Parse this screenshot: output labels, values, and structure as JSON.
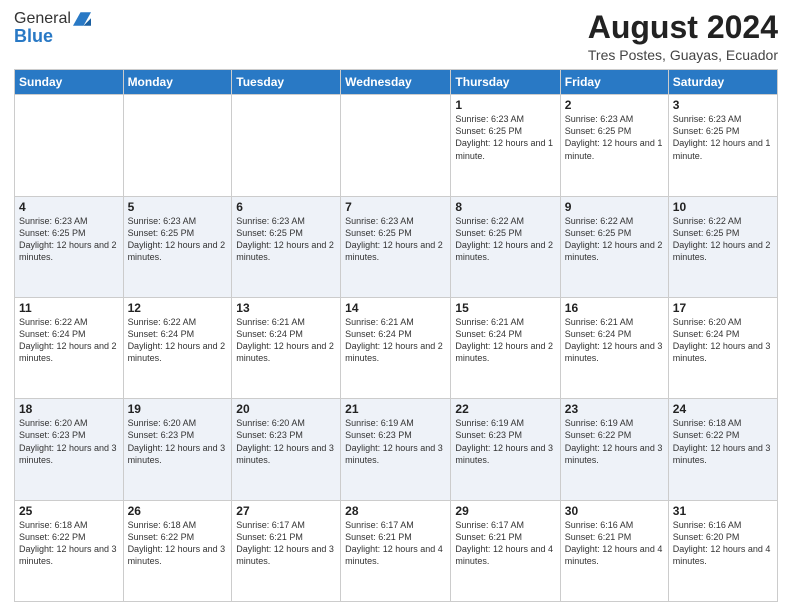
{
  "logo": {
    "general": "General",
    "blue": "Blue"
  },
  "header": {
    "month": "August 2024",
    "location": "Tres Postes, Guayas, Ecuador"
  },
  "weekdays": [
    "Sunday",
    "Monday",
    "Tuesday",
    "Wednesday",
    "Thursday",
    "Friday",
    "Saturday"
  ],
  "weeks": [
    [
      {
        "day": "",
        "info": ""
      },
      {
        "day": "",
        "info": ""
      },
      {
        "day": "",
        "info": ""
      },
      {
        "day": "",
        "info": ""
      },
      {
        "day": "1",
        "info": "Sunrise: 6:23 AM\nSunset: 6:25 PM\nDaylight: 12 hours and 1 minute."
      },
      {
        "day": "2",
        "info": "Sunrise: 6:23 AM\nSunset: 6:25 PM\nDaylight: 12 hours and 1 minute."
      },
      {
        "day": "3",
        "info": "Sunrise: 6:23 AM\nSunset: 6:25 PM\nDaylight: 12 hours and 1 minute."
      }
    ],
    [
      {
        "day": "4",
        "info": "Sunrise: 6:23 AM\nSunset: 6:25 PM\nDaylight: 12 hours and 2 minutes."
      },
      {
        "day": "5",
        "info": "Sunrise: 6:23 AM\nSunset: 6:25 PM\nDaylight: 12 hours and 2 minutes."
      },
      {
        "day": "6",
        "info": "Sunrise: 6:23 AM\nSunset: 6:25 PM\nDaylight: 12 hours and 2 minutes."
      },
      {
        "day": "7",
        "info": "Sunrise: 6:23 AM\nSunset: 6:25 PM\nDaylight: 12 hours and 2 minutes."
      },
      {
        "day": "8",
        "info": "Sunrise: 6:22 AM\nSunset: 6:25 PM\nDaylight: 12 hours and 2 minutes."
      },
      {
        "day": "9",
        "info": "Sunrise: 6:22 AM\nSunset: 6:25 PM\nDaylight: 12 hours and 2 minutes."
      },
      {
        "day": "10",
        "info": "Sunrise: 6:22 AM\nSunset: 6:25 PM\nDaylight: 12 hours and 2 minutes."
      }
    ],
    [
      {
        "day": "11",
        "info": "Sunrise: 6:22 AM\nSunset: 6:24 PM\nDaylight: 12 hours and 2 minutes."
      },
      {
        "day": "12",
        "info": "Sunrise: 6:22 AM\nSunset: 6:24 PM\nDaylight: 12 hours and 2 minutes."
      },
      {
        "day": "13",
        "info": "Sunrise: 6:21 AM\nSunset: 6:24 PM\nDaylight: 12 hours and 2 minutes."
      },
      {
        "day": "14",
        "info": "Sunrise: 6:21 AM\nSunset: 6:24 PM\nDaylight: 12 hours and 2 minutes."
      },
      {
        "day": "15",
        "info": "Sunrise: 6:21 AM\nSunset: 6:24 PM\nDaylight: 12 hours and 2 minutes."
      },
      {
        "day": "16",
        "info": "Sunrise: 6:21 AM\nSunset: 6:24 PM\nDaylight: 12 hours and 3 minutes."
      },
      {
        "day": "17",
        "info": "Sunrise: 6:20 AM\nSunset: 6:24 PM\nDaylight: 12 hours and 3 minutes."
      }
    ],
    [
      {
        "day": "18",
        "info": "Sunrise: 6:20 AM\nSunset: 6:23 PM\nDaylight: 12 hours and 3 minutes."
      },
      {
        "day": "19",
        "info": "Sunrise: 6:20 AM\nSunset: 6:23 PM\nDaylight: 12 hours and 3 minutes."
      },
      {
        "day": "20",
        "info": "Sunrise: 6:20 AM\nSunset: 6:23 PM\nDaylight: 12 hours and 3 minutes."
      },
      {
        "day": "21",
        "info": "Sunrise: 6:19 AM\nSunset: 6:23 PM\nDaylight: 12 hours and 3 minutes."
      },
      {
        "day": "22",
        "info": "Sunrise: 6:19 AM\nSunset: 6:23 PM\nDaylight: 12 hours and 3 minutes."
      },
      {
        "day": "23",
        "info": "Sunrise: 6:19 AM\nSunset: 6:22 PM\nDaylight: 12 hours and 3 minutes."
      },
      {
        "day": "24",
        "info": "Sunrise: 6:18 AM\nSunset: 6:22 PM\nDaylight: 12 hours and 3 minutes."
      }
    ],
    [
      {
        "day": "25",
        "info": "Sunrise: 6:18 AM\nSunset: 6:22 PM\nDaylight: 12 hours and 3 minutes."
      },
      {
        "day": "26",
        "info": "Sunrise: 6:18 AM\nSunset: 6:22 PM\nDaylight: 12 hours and 3 minutes."
      },
      {
        "day": "27",
        "info": "Sunrise: 6:17 AM\nSunset: 6:21 PM\nDaylight: 12 hours and 3 minutes."
      },
      {
        "day": "28",
        "info": "Sunrise: 6:17 AM\nSunset: 6:21 PM\nDaylight: 12 hours and 4 minutes."
      },
      {
        "day": "29",
        "info": "Sunrise: 6:17 AM\nSunset: 6:21 PM\nDaylight: 12 hours and 4 minutes."
      },
      {
        "day": "30",
        "info": "Sunrise: 6:16 AM\nSunset: 6:21 PM\nDaylight: 12 hours and 4 minutes."
      },
      {
        "day": "31",
        "info": "Sunrise: 6:16 AM\nSunset: 6:20 PM\nDaylight: 12 hours and 4 minutes."
      }
    ]
  ]
}
